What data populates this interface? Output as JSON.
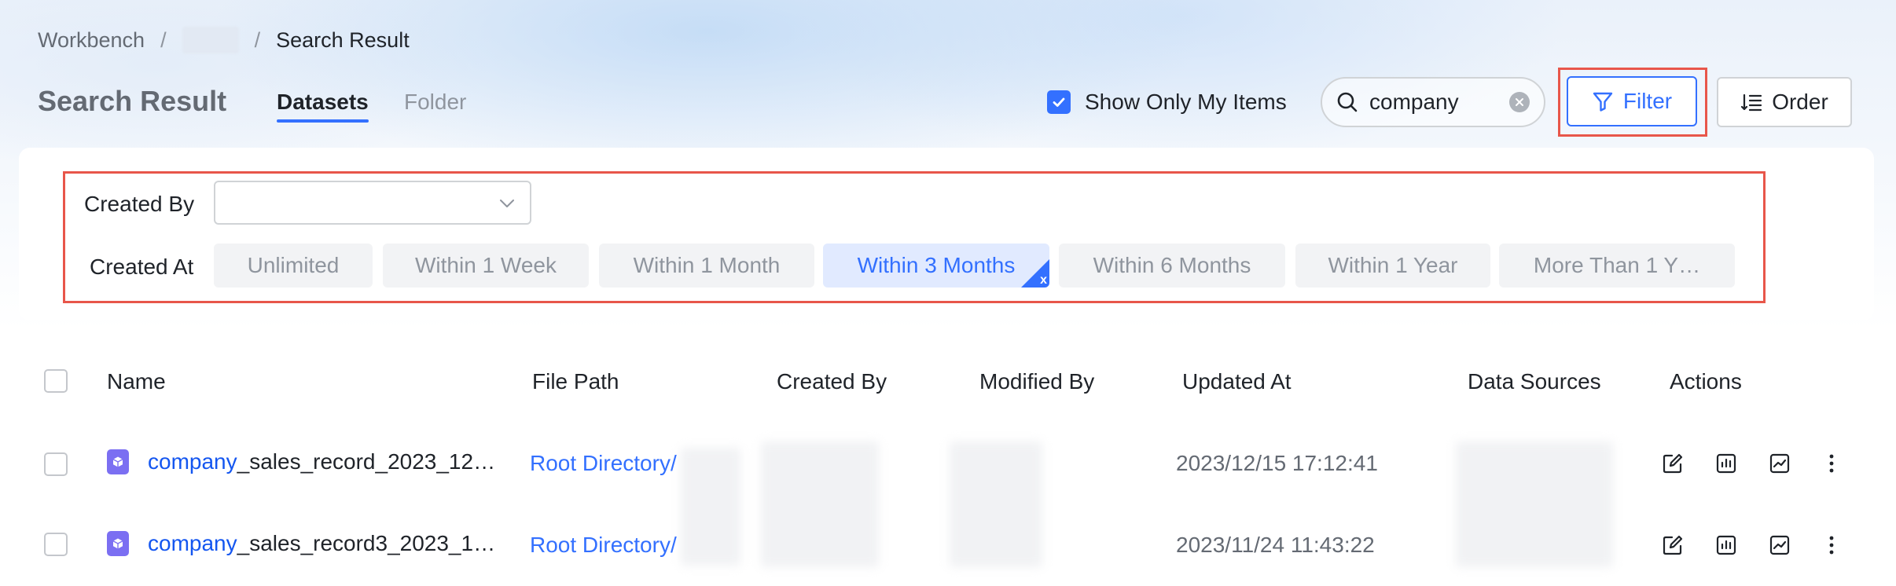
{
  "breadcrumb": {
    "root": "Workbench",
    "separator": "/",
    "current": "Search Result"
  },
  "page": {
    "title": "Search Result"
  },
  "tabs": [
    {
      "label": "Datasets",
      "active": true
    },
    {
      "label": "Folder",
      "active": false
    }
  ],
  "toolbar": {
    "show_mine_label": "Show Only My Items",
    "show_mine_checked": true,
    "search_value": "company",
    "filter_label": "Filter",
    "order_label": "Order"
  },
  "filters": {
    "created_by_label": "Created By",
    "created_by_value": "",
    "created_at_label": "Created At",
    "created_at_options": [
      {
        "label": "Unlimited",
        "active": false
      },
      {
        "label": "Within 1 Week",
        "active": false
      },
      {
        "label": "Within 1 Month",
        "active": false
      },
      {
        "label": "Within 3 Months",
        "active": true
      },
      {
        "label": "Within 6 Months",
        "active": false
      },
      {
        "label": "Within 1 Year",
        "active": false
      },
      {
        "label": "More Than 1 Y…",
        "active": false
      }
    ],
    "active_close_glyph": "x"
  },
  "table": {
    "columns": [
      "Name",
      "File Path",
      "Created By",
      "Modified By",
      "Updated At",
      "Data Sources",
      "Actions"
    ],
    "rows": [
      {
        "name_match": "company",
        "name_rest": "_sales_record_2023_12…",
        "file_path": "Root Directory/",
        "updated_at": "2023/12/15 17:12:41"
      },
      {
        "name_match": "company",
        "name_rest": "_sales_record3_2023_1…",
        "file_path": "Root Directory/",
        "updated_at": "2023/11/24 11:43:22"
      }
    ]
  },
  "colors": {
    "accent": "#3370ff",
    "highlight_border": "#e8564a",
    "dataset_icon": "#7b6ff2"
  },
  "icons": {
    "search": "search-icon",
    "clear": "clear-icon",
    "filter": "funnel-icon",
    "order": "sort-list-icon",
    "edit": "edit-icon",
    "analyze": "bar-chart-icon",
    "trend": "line-chart-icon",
    "more": "more-vertical-icon"
  }
}
